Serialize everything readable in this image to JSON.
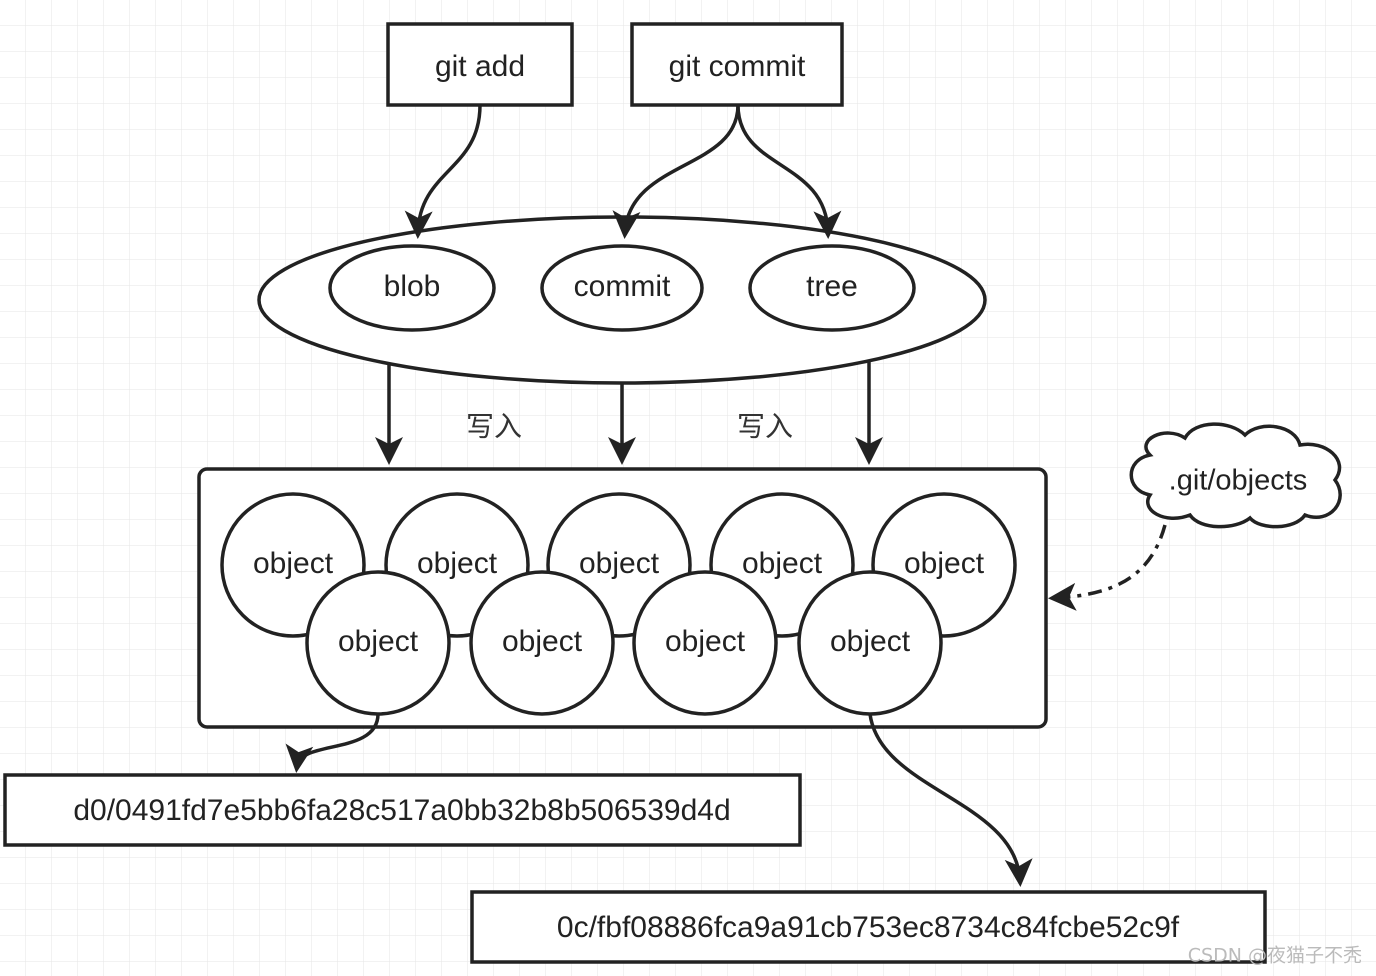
{
  "commands": {
    "add": "git add",
    "commit": "git commit"
  },
  "object_types": [
    "blob",
    "commit",
    "tree"
  ],
  "write_label": "写入",
  "store_label": ".git/objects",
  "object_label": "object",
  "object_count": 9,
  "hashes": [
    "d0/0491fd7e5bb6fa28c517a0bb32b8b506539d4d",
    "0c/fbf08886fca9a91cb753ec8734c84fcbe52c9f"
  ],
  "watermark": "CSDN @夜猫子不秃"
}
